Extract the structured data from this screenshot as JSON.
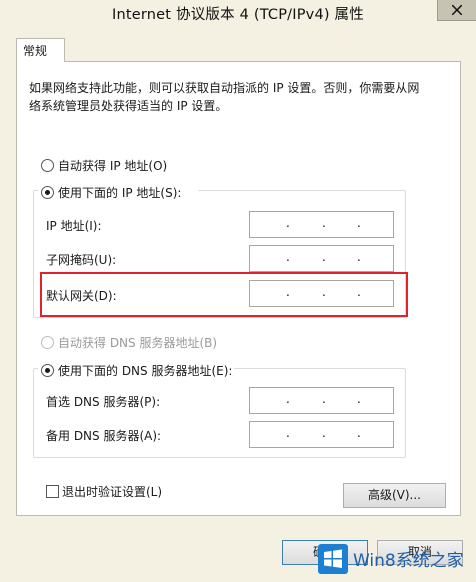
{
  "window": {
    "title": "Internet 协议版本 4 (TCP/IPv4) 属性"
  },
  "tabs": [
    {
      "label": "常规"
    }
  ],
  "description": {
    "line1": "如果网络支持此功能，则可以获取自动指派的 IP 设置。否则，你需要从网",
    "line2": "络系统管理员处获得适当的 IP 设置。"
  },
  "ip": {
    "auto_label": "自动获得 IP 地址(O)",
    "auto_checked": false,
    "manual_label": "使用下面的 IP 地址(S):",
    "manual_checked": true,
    "fields": [
      {
        "label": "IP 地址(I):",
        "value": ". . ."
      },
      {
        "label": "子网掩码(U):",
        "value": ". . ."
      },
      {
        "label": "默认网关(D):",
        "value": ". . ."
      }
    ]
  },
  "dns": {
    "auto_label": "自动获得 DNS 服务器地址(B)",
    "auto_checked": false,
    "auto_disabled": true,
    "manual_label": "使用下面的 DNS 服务器地址(E):",
    "manual_checked": true,
    "fields": [
      {
        "label": "首选 DNS 服务器(P):",
        "value": ". . ."
      },
      {
        "label": "备用 DNS 服务器(A):",
        "value": ". . ."
      }
    ]
  },
  "validate_on_exit": {
    "label": "退出时验证设置(L)",
    "checked": false
  },
  "buttons": {
    "advanced": "高级(V)...",
    "ok": "确定",
    "cancel": "取消"
  },
  "watermark": {
    "text": "Win8系统之家"
  },
  "colors": {
    "highlight": "#e0222b",
    "dialog_bg": "#f4f1e3",
    "watermark": "#1d5fa8"
  }
}
